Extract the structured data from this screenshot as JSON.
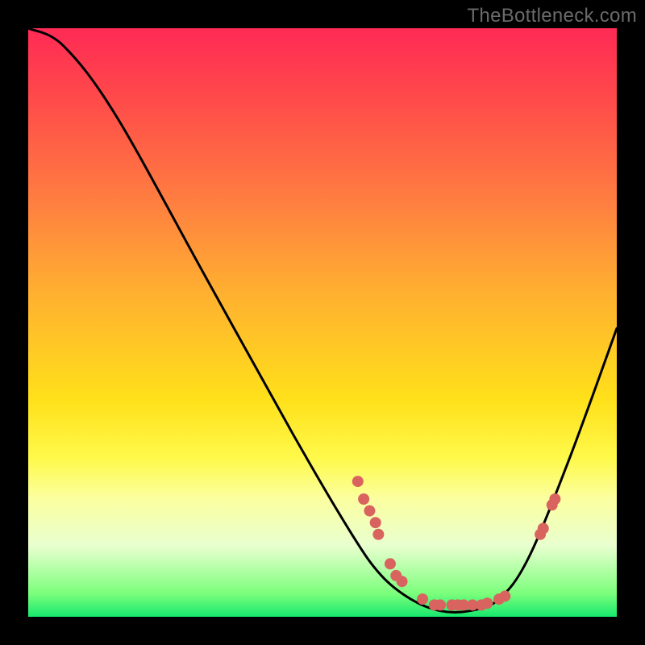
{
  "watermark": "TheBottleneck.com",
  "chart_data": {
    "type": "line",
    "title": "",
    "xlabel": "",
    "ylabel": "",
    "xlim": [
      0,
      100
    ],
    "ylim": [
      0,
      100
    ],
    "grid": false,
    "legend": false,
    "curve": {
      "name": "bottleneck-curve",
      "color": "#000000",
      "points": [
        {
          "x": 0,
          "y": 100
        },
        {
          "x": 6,
          "y": 97
        },
        {
          "x": 15,
          "y": 85
        },
        {
          "x": 30,
          "y": 58
        },
        {
          "x": 45,
          "y": 31
        },
        {
          "x": 55,
          "y": 14
        },
        {
          "x": 60,
          "y": 7
        },
        {
          "x": 65,
          "y": 3
        },
        {
          "x": 70,
          "y": 1
        },
        {
          "x": 75,
          "y": 1
        },
        {
          "x": 80,
          "y": 3
        },
        {
          "x": 85,
          "y": 10
        },
        {
          "x": 92,
          "y": 27
        },
        {
          "x": 100,
          "y": 49
        }
      ]
    },
    "markers": {
      "name": "data-points",
      "color": "#d9645f",
      "radius_px": 7,
      "points": [
        {
          "x": 56,
          "y": 23
        },
        {
          "x": 57,
          "y": 20
        },
        {
          "x": 58,
          "y": 18
        },
        {
          "x": 59,
          "y": 16
        },
        {
          "x": 59.5,
          "y": 14
        },
        {
          "x": 61.5,
          "y": 9
        },
        {
          "x": 62.5,
          "y": 7
        },
        {
          "x": 63.5,
          "y": 6
        },
        {
          "x": 67,
          "y": 3
        },
        {
          "x": 69,
          "y": 2
        },
        {
          "x": 70,
          "y": 2
        },
        {
          "x": 72,
          "y": 2
        },
        {
          "x": 73,
          "y": 2
        },
        {
          "x": 74,
          "y": 2
        },
        {
          "x": 75.5,
          "y": 2
        },
        {
          "x": 77,
          "y": 2
        },
        {
          "x": 78,
          "y": 2.3
        },
        {
          "x": 80,
          "y": 3
        },
        {
          "x": 81,
          "y": 3.5
        },
        {
          "x": 87,
          "y": 14
        },
        {
          "x": 87.5,
          "y": 15
        },
        {
          "x": 89,
          "y": 19
        },
        {
          "x": 89.5,
          "y": 20
        }
      ]
    }
  }
}
